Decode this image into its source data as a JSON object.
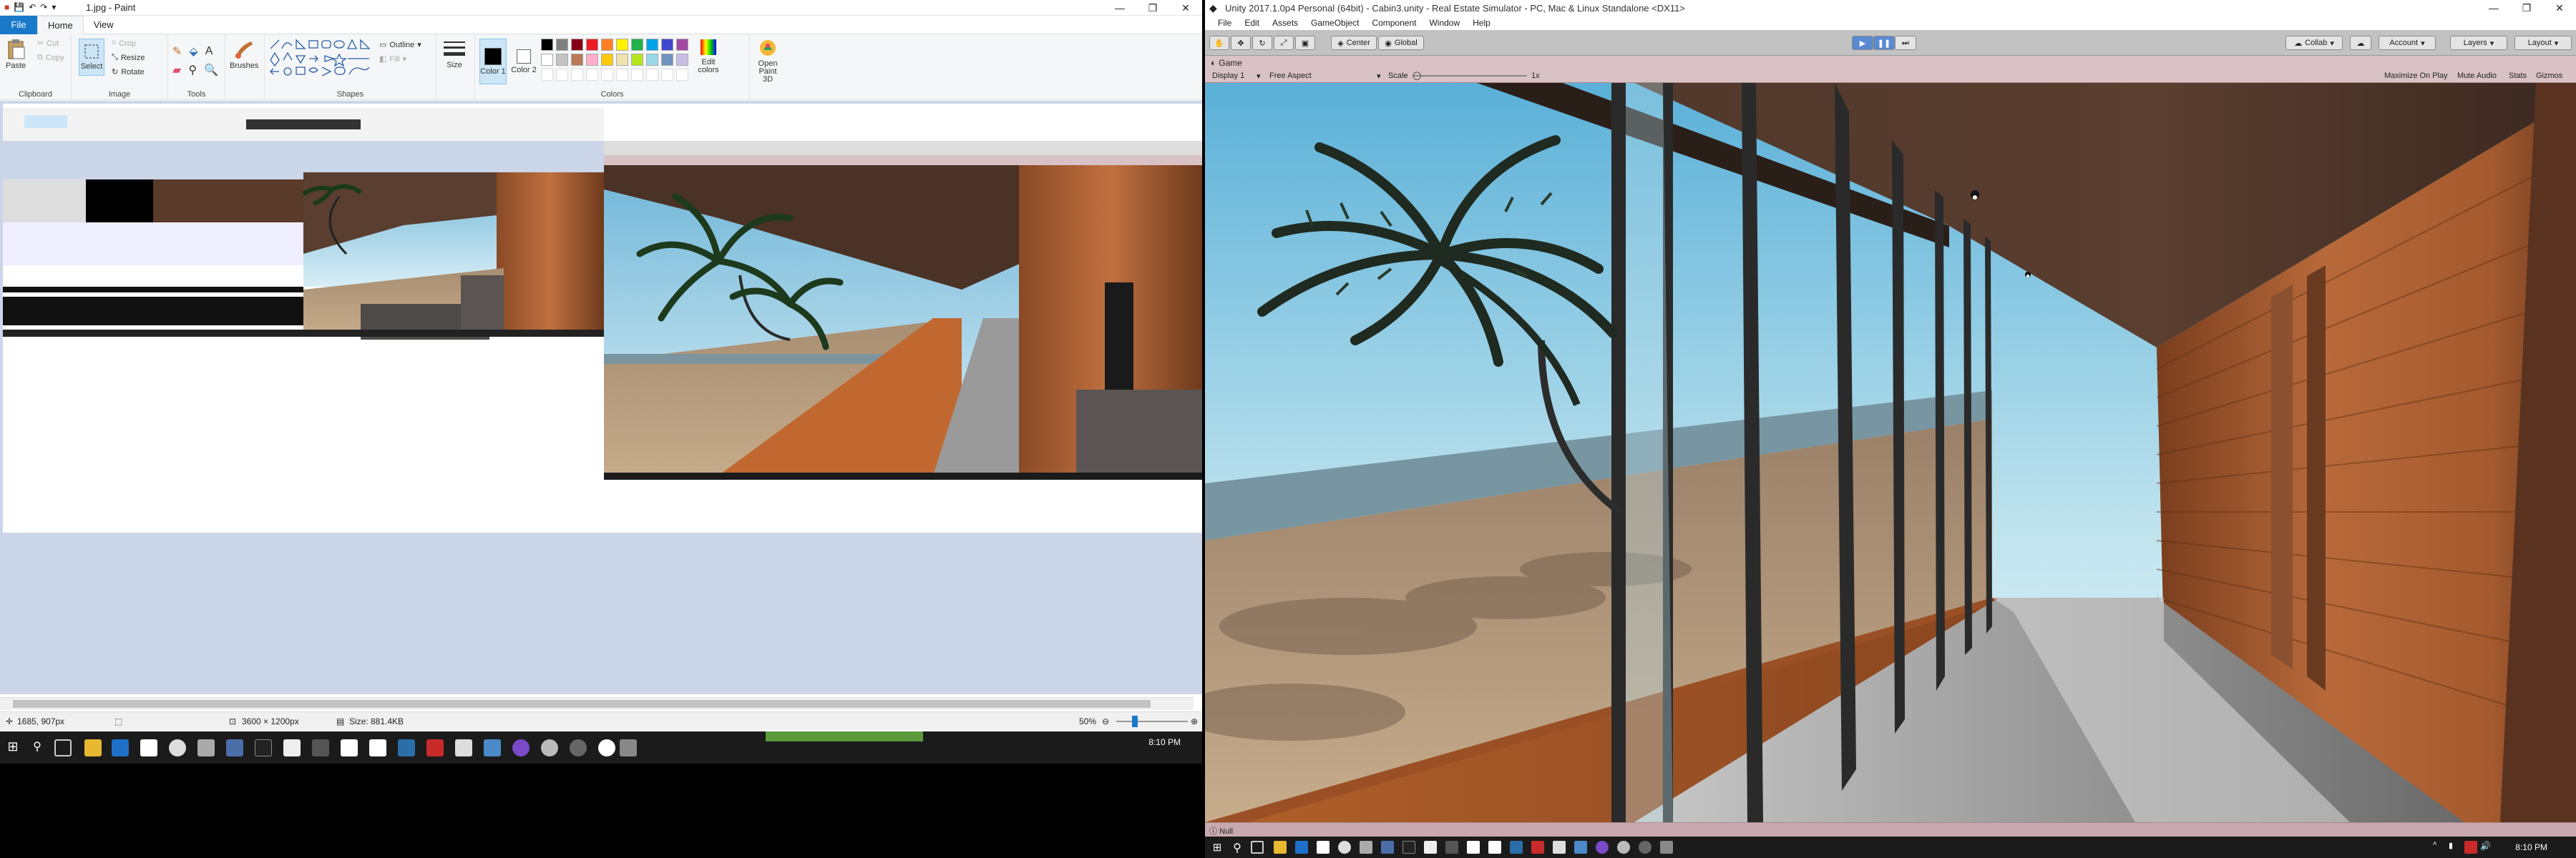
{
  "paint": {
    "title": "1.jpg - Paint",
    "menu": {
      "file": "File",
      "home": "Home",
      "view": "View"
    },
    "ribbon": {
      "clipboard": {
        "label": "Clipboard",
        "paste": "Paste",
        "cut": "Cut",
        "copy": "Copy"
      },
      "image": {
        "label": "Image",
        "select": "Select",
        "crop": "Crop",
        "resize": "Resize",
        "rotate": "Rotate"
      },
      "tools": {
        "label": "Tools"
      },
      "brushes": "Brushes",
      "shapes": {
        "label": "Shapes",
        "outline": "Outline",
        "fill": "Fill"
      },
      "size": "Size",
      "color1": "Color 1",
      "color2": "Color 2",
      "colors_label": "Colors",
      "edit_colors": "Edit colors",
      "paint3d": "Open Paint 3D"
    },
    "palette": [
      "#000000",
      "#7f7f7f",
      "#880015",
      "#ed1c24",
      "#ff7f27",
      "#fff200",
      "#22b14c",
      "#00a2e8",
      "#3f48cc",
      "#a349a4",
      "#ffffff",
      "#c3c3c3",
      "#b97a57",
      "#ffaec9",
      "#ffc90e",
      "#efe4b0",
      "#b5e61d",
      "#99d9ea",
      "#7092be",
      "#c8bfe7"
    ],
    "status": {
      "cursor": "1685, 907px",
      "dimensions": "3600 × 1200px",
      "size": "Size: 881.4KB",
      "zoom": "50%"
    }
  },
  "taskbar_left": {
    "time": "8:10 PM"
  },
  "unity": {
    "title": "Unity 2017.1.0p4 Personal (64bit) - Cabin3.unity - Real Estate Simulator - PC, Mac & Linux Standalone <DX11>",
    "menu": [
      "File",
      "Edit",
      "Assets",
      "GameObject",
      "Component",
      "Window",
      "Help"
    ],
    "toolbar": {
      "center": "Center",
      "global": "Global",
      "collab": "Collab",
      "account": "Account",
      "layers": "Layers",
      "layout": "Layout"
    },
    "game": {
      "tab": "Game",
      "display": "Display 1",
      "aspect": "Free Aspect",
      "scale_label": "Scale",
      "scale_value": "1x",
      "maximize": "Maximize On Play",
      "mute": "Mute Audio",
      "stats": "Stats",
      "gizmos": "Gizmos"
    },
    "bottom": "Null"
  },
  "taskbar_right": {
    "time": "8:10 PM"
  }
}
